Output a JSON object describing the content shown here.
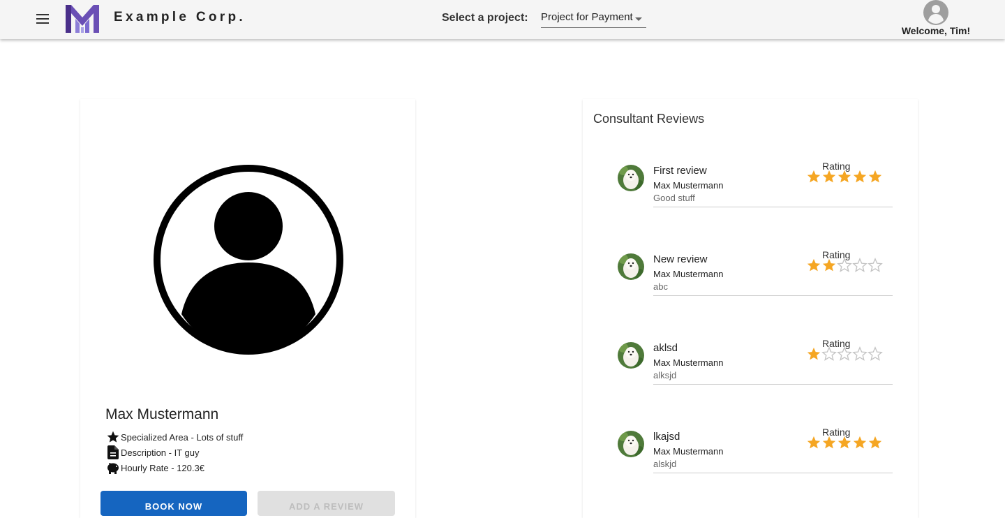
{
  "header": {
    "brand": "Example Corp.",
    "project_label": "Select a project:",
    "project_selected": "Project for Payment",
    "welcome": "Welcome, Tim!"
  },
  "consultant": {
    "name": "Max Mustermann",
    "specialized": "Specialized Area - Lots of stuff",
    "description": "Description - IT guy",
    "rate": "Hourly Rate - 120.3€",
    "book_label": "BOOK NOW",
    "review_label": "ADD A REVIEW"
  },
  "reviews_panel": {
    "title": "Consultant Reviews",
    "rating_label": "Rating",
    "items": [
      {
        "title": "First review",
        "author": "Max Mustermann",
        "text": "Good stuff",
        "rating": 5
      },
      {
        "title": "New review",
        "author": "Max Mustermann",
        "text": "abc",
        "rating": 2
      },
      {
        "title": "aklsd",
        "author": "Max Mustermann",
        "text": "alksjd",
        "rating": 1
      },
      {
        "title": "lkajsd",
        "author": "Max Mustermann",
        "text": "alskjd",
        "rating": 5
      }
    ]
  },
  "colors": {
    "accent": "#1565c0",
    "star_filled": "#f5a623",
    "star_empty": "#c4c4c4",
    "logo_purple": "#5b3fa0"
  }
}
